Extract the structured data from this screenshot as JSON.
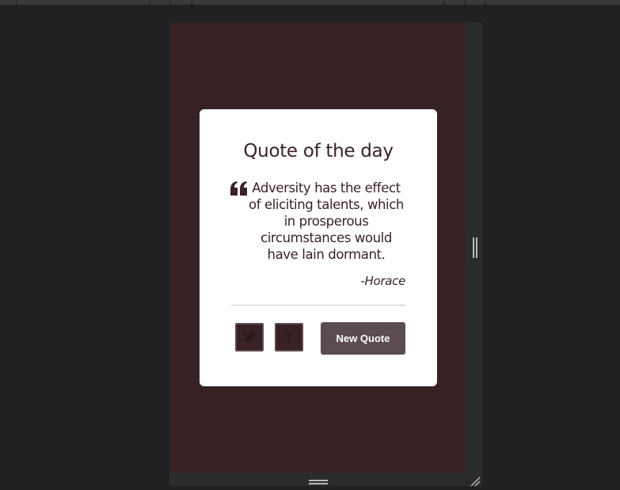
{
  "card": {
    "title": "Quote of the day",
    "quote": "Adversity has the effect of eliciting talents, which in prosperous circumstances would have lain dormant.",
    "author": "-Horace",
    "new_quote_label": "New Quote",
    "quote_icon": "left-double-quote-icon",
    "share_icons": [
      "twitter-icon",
      "tumblr-icon"
    ],
    "tumblr_glyph": "t"
  },
  "colors": {
    "page_background": "#372124",
    "card_background": "#ffffff",
    "button_background": "#5b4d4f",
    "text": "#3a2226"
  }
}
